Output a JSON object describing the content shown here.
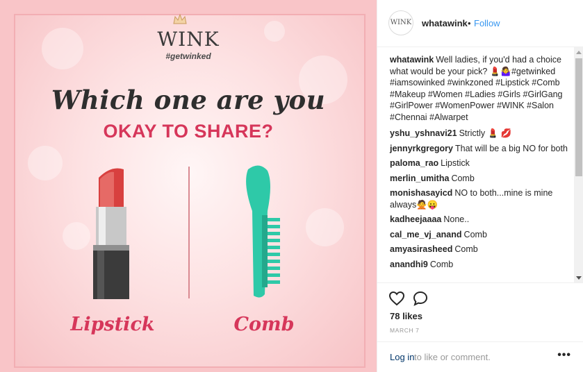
{
  "post_image": {
    "logo_word": "WINK",
    "logo_tag": "#getwinked",
    "headline": "Which one are you",
    "subhead": "OKAY TO SHARE?",
    "option_left": "Lipstick",
    "option_right": "Comb",
    "colors": {
      "accent_pink": "#d6365a",
      "background": "#f9c5c8"
    }
  },
  "header": {
    "avatar_text": "WINK",
    "username": "whatawink",
    "separator": "•",
    "follow_label": "Follow"
  },
  "caption": {
    "username": "whatawink",
    "text": "Well ladies, if you'd had a choice what would be your pick? 💄🤷‍♀️#getwinked #iamsowinked #winkzoned #Lipstick #Comb #Makeup #Women #Ladies #Girls #GirlGang #GirlPower #WomenPower #WINK #Salon #Chennai #Alwarpet"
  },
  "comments": [
    {
      "username": "yshu_yshnavi21",
      "text": "Strictly 💄 💋"
    },
    {
      "username": "jennyrkgregory",
      "text": "That will be a big NO for both"
    },
    {
      "username": "paloma_rao",
      "text": "Lipstick"
    },
    {
      "username": "merlin_umitha",
      "text": "Comb"
    },
    {
      "username": "monishasayicd",
      "text": "NO to both...mine is mine always🙅😛"
    },
    {
      "username": "kadheejaaaa",
      "text": "None.."
    },
    {
      "username": "cal_me_vj_anand",
      "text": "Comb"
    },
    {
      "username": "amyasirasheed",
      "text": "Comb"
    },
    {
      "username": "anandhi9",
      "text": "Comb"
    }
  ],
  "actions": {
    "like_icon": "heart-icon",
    "comment_icon": "comment-icon"
  },
  "likes": "78 likes",
  "date": "MARCH 7",
  "footer": {
    "login_label": "Log in",
    "login_rest": "to like or comment.",
    "more_label": "•••"
  }
}
